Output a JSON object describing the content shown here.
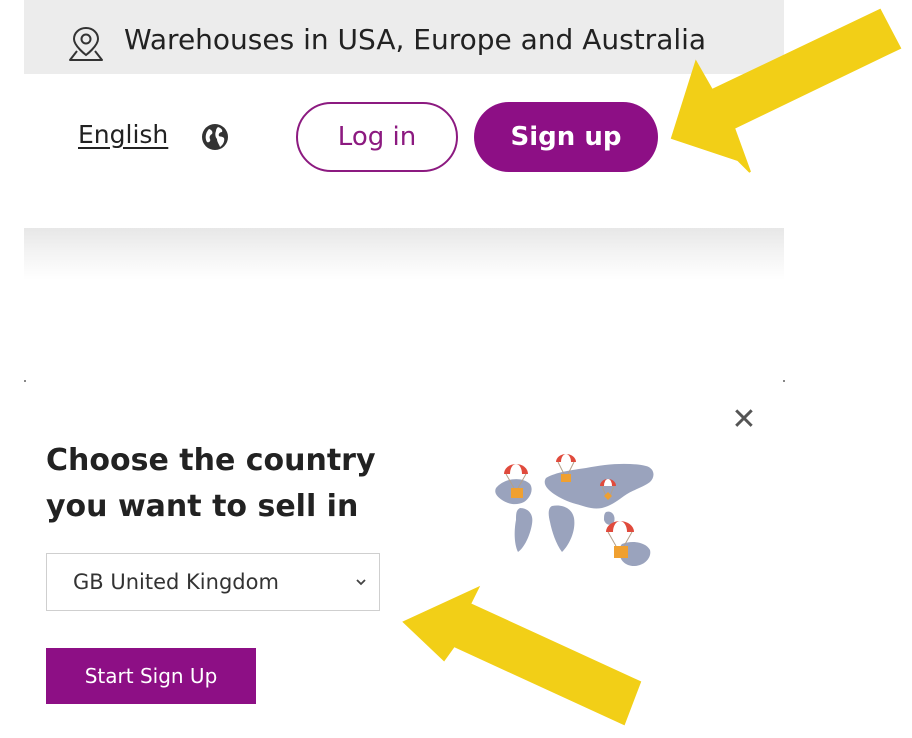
{
  "topbar": {
    "icon": "location-pin-icon",
    "text": "Warehouses in USA, Europe and Australia"
  },
  "header": {
    "language_label": "English",
    "language_icon": "globe-icon",
    "login_label": "Log in",
    "signup_label": "Sign up"
  },
  "popup": {
    "title_line1": "Choose the country",
    "title_line2": "you want to sell in",
    "close_icon": "close-icon",
    "illustration": "world-map-parachute-boxes-illustration",
    "country_select": {
      "selected": "GB United Kingdom"
    },
    "start_label": "Start Sign Up"
  },
  "colors": {
    "brand_purple": "#8d0f85",
    "topbar_bg": "#ececec",
    "arrow_yellow": "#f2cf17"
  },
  "annotations": {
    "arrow_icon": "yellow-arrow-icon"
  }
}
